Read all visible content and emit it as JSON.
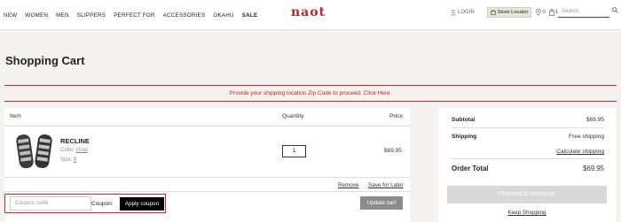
{
  "header": {
    "nav": [
      "NEW",
      "WOMEN",
      "MEN",
      "SLIPPERS",
      "PERFECT FOR",
      "ACCESSORIES",
      "OKAHU",
      "SALE"
    ],
    "logo": "naot",
    "login": "LOGIN",
    "store_locator": "Store Locator",
    "wishlist_count": "0",
    "bag_count": "1",
    "search_placeholder": "Search"
  },
  "page_title": "Shopping Cart",
  "zip_banner": "Provide your shipping location Zip Code to proceed. Click Here.",
  "cart": {
    "columns": {
      "item": "Item",
      "quantity": "Quantity",
      "price": "Price"
    },
    "items": [
      {
        "name": "RECLINE",
        "color_label": "Color:",
        "color": "Gray",
        "size_label": "Size:",
        "size": "8",
        "quantity": "1",
        "price": "$69.95"
      }
    ],
    "remove": "Remove",
    "save_for_later": "Save for Later",
    "coupon_placeholder": "Coupon code",
    "coupon_label": "Coupon",
    "apply_coupon": "Apply coupon",
    "update_cart": "Update cart"
  },
  "summary": {
    "subtotal_label": "Subtotal",
    "subtotal": "$69.95",
    "shipping_label": "Shipping",
    "shipping": "Free shipping",
    "calculate_shipping": "Calculate shipping",
    "total_label": "Order Total",
    "total": "$69.95",
    "checkout": "Proceed to checkout",
    "keep_shopping": "Keep Shopping"
  },
  "colors": {
    "brand": "#b4262a",
    "highlight_border": "#d7262e",
    "apply_button": "#000000",
    "disabled_button": "#d9d8d6"
  }
}
